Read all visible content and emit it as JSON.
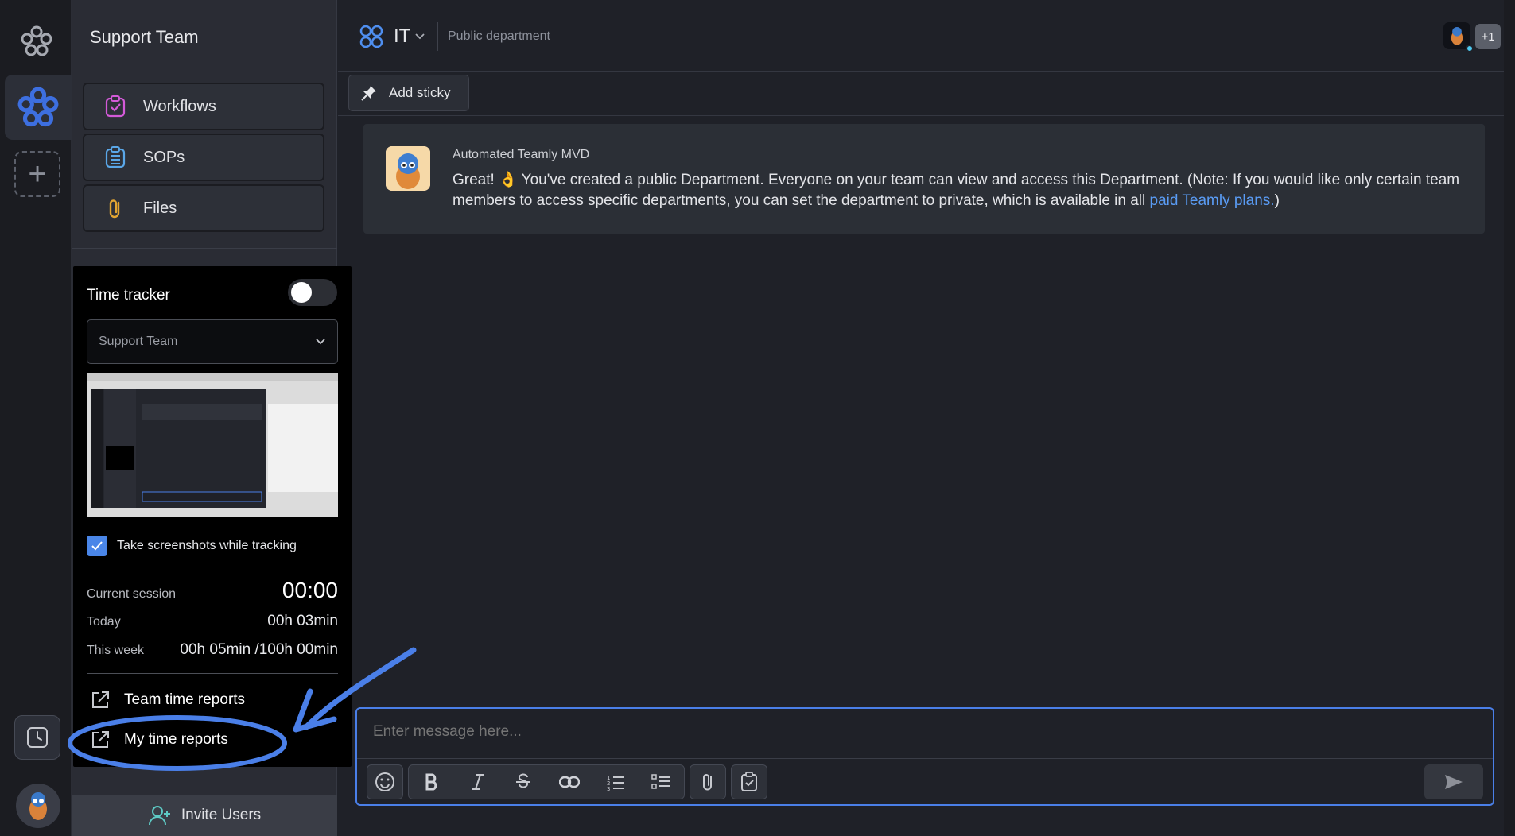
{
  "sidebar": {
    "title": "Support Team",
    "items": [
      {
        "label": "Workflows",
        "icon": "workflow-icon"
      },
      {
        "label": "SOPs",
        "icon": "sop-list-icon"
      },
      {
        "label": "Files",
        "icon": "paperclip-icon"
      }
    ],
    "invite_label": "Invite Users"
  },
  "header": {
    "department": "IT",
    "department_type": "Public department",
    "extra_members": "+1"
  },
  "toolbar": {
    "add_sticky_label": "Add sticky"
  },
  "message": {
    "author": "Automated Teamly MVD",
    "text_before": "Great! 👌 You've created a public Department. Everyone on your team can view and access this Department. (Note: If you would like only certain team members to access specific departments, you can set the department to private, which is available in all ",
    "link_text": "paid Teamly plans.",
    "text_after": ")"
  },
  "composer": {
    "placeholder": "Enter message here...",
    "tools": [
      "emoji-icon",
      "bold-icon",
      "italic-icon",
      "strikethrough-icon",
      "link-icon",
      "ordered-list-icon",
      "bullet-list-icon",
      "attachment-icon",
      "task-icon",
      "send-icon"
    ]
  },
  "time_tracker": {
    "title": "Time tracker",
    "enabled": false,
    "selected_team": "Support Team",
    "screenshots_label": "Take screenshots while tracking",
    "screenshots_enabled": true,
    "current_session_label": "Current session",
    "current_session": "00:00",
    "today_label": "Today",
    "today": "00h 03min",
    "week_label": "This week",
    "week": "00h 05min /100h 00min",
    "team_reports_label": "Team time reports",
    "my_reports_label": "My time reports"
  },
  "colors": {
    "accent": "#4a7fe8",
    "link": "#5a9cf5",
    "annotation": "#4a7fe8"
  }
}
